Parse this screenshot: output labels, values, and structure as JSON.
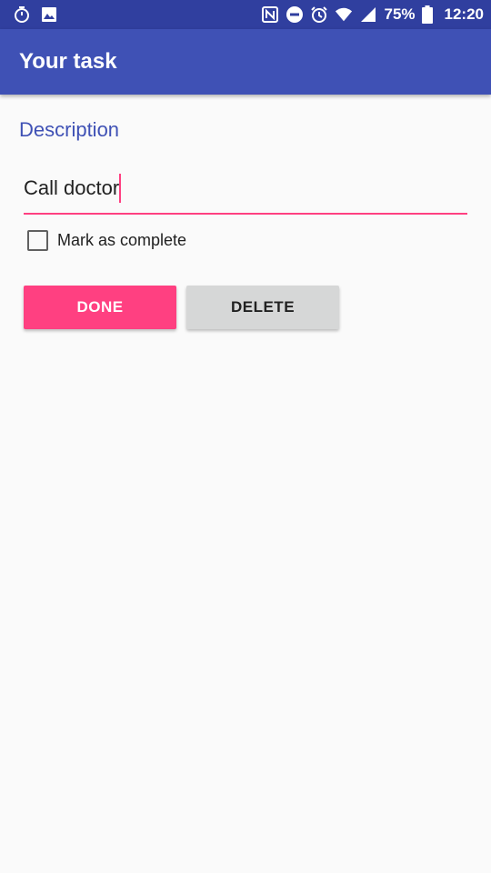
{
  "status_bar": {
    "left_icons": [
      "stopwatch-icon",
      "image-icon"
    ],
    "right_icons": [
      "nfc-icon",
      "do-not-disturb-icon",
      "alarm-icon",
      "wifi-icon",
      "signal-icon"
    ],
    "battery": "75%",
    "time": "12:20"
  },
  "app_bar": {
    "title": "Your task"
  },
  "form": {
    "description_label": "Description",
    "description_value": "Call doctor",
    "checkbox_label": "Mark as complete",
    "checkbox_checked": false,
    "done_label": "DONE",
    "delete_label": "DELETE"
  },
  "colors": {
    "status_bar": "#303f9f",
    "primary": "#3f51b5",
    "accent": "#ff4081",
    "background": "#fafafa",
    "delete_button": "#d6d7d7"
  }
}
